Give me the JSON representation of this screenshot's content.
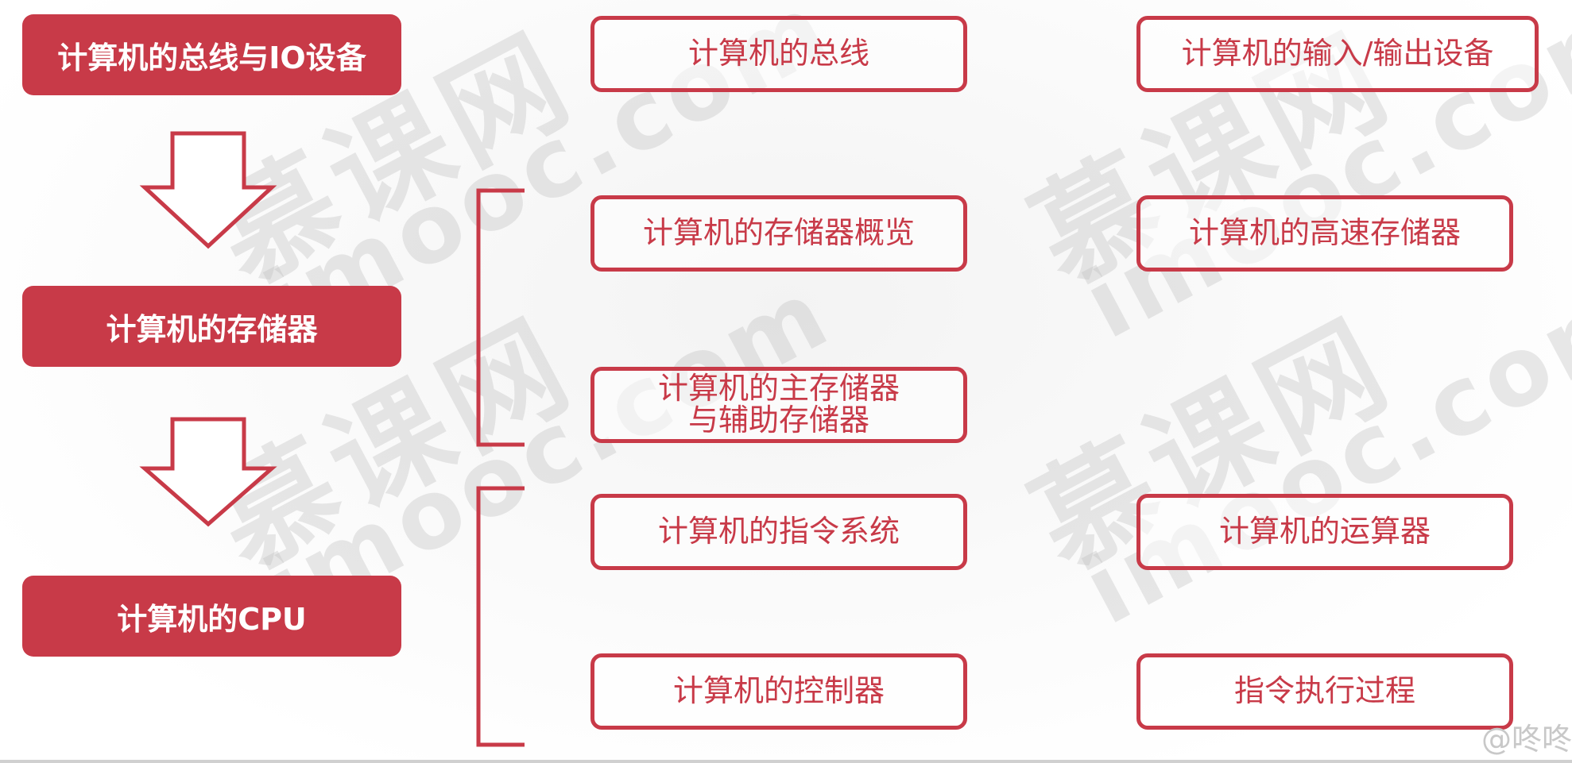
{
  "colors": {
    "accent": "#c83a48",
    "text_on_accent": "#ffffff"
  },
  "watermark": {
    "cn": "慕课网",
    "en": "imooc.com"
  },
  "left_column": [
    {
      "label": "计算机的总线与IO设备"
    },
    {
      "label": "计算机的存储器"
    },
    {
      "label": "计算机的CPU"
    }
  ],
  "topics": {
    "bus": "计算机的总线",
    "io": "计算机的输入/输出设备",
    "storage_overview": "计算机的存储器概览",
    "cache": "计算机的高速存储器",
    "main_storage_line1": "计算机的主存储器",
    "main_storage_line2": "与辅助存储器",
    "instruction_system": "计算机的指令系统",
    "alu": "计算机的运算器",
    "controller": "计算机的控制器",
    "execution": "指令执行过程"
  },
  "credit": "@咚咚"
}
